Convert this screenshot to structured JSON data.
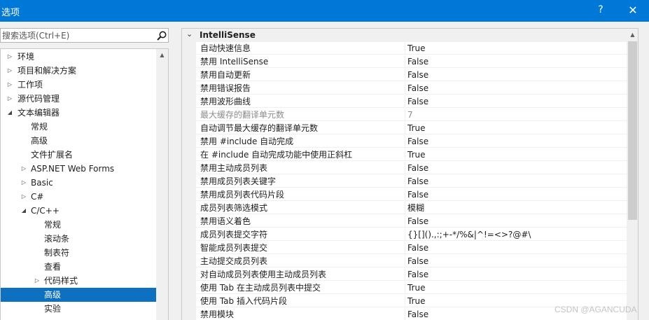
{
  "window": {
    "title": "选项",
    "help_label": "?",
    "close_label": "✕"
  },
  "search": {
    "placeholder": "搜索选项(Ctrl+E)",
    "icon": "search-icon"
  },
  "tree": {
    "items": [
      {
        "label": "环境",
        "indent": 0,
        "arrow": "collapsed"
      },
      {
        "label": "项目和解决方案",
        "indent": 0,
        "arrow": "collapsed"
      },
      {
        "label": "工作项",
        "indent": 0,
        "arrow": "collapsed"
      },
      {
        "label": "源代码管理",
        "indent": 0,
        "arrow": "collapsed"
      },
      {
        "label": "文本编辑器",
        "indent": 0,
        "arrow": "expanded"
      },
      {
        "label": "常规",
        "indent": 1,
        "arrow": "none"
      },
      {
        "label": "高级",
        "indent": 1,
        "arrow": "none"
      },
      {
        "label": "文件扩展名",
        "indent": 1,
        "arrow": "none"
      },
      {
        "label": "ASP.NET Web Forms",
        "indent": 1,
        "arrow": "collapsed"
      },
      {
        "label": "Basic",
        "indent": 1,
        "arrow": "collapsed"
      },
      {
        "label": "C#",
        "indent": 1,
        "arrow": "collapsed"
      },
      {
        "label": "C/C++",
        "indent": 1,
        "arrow": "expanded"
      },
      {
        "label": "常规",
        "indent": 2,
        "arrow": "none"
      },
      {
        "label": "滚动条",
        "indent": 2,
        "arrow": "none"
      },
      {
        "label": "制表符",
        "indent": 2,
        "arrow": "none"
      },
      {
        "label": "查看",
        "indent": 2,
        "arrow": "none"
      },
      {
        "label": "代码样式",
        "indent": 2,
        "arrow": "collapsed"
      },
      {
        "label": "高级",
        "indent": 2,
        "arrow": "none",
        "selected": true
      },
      {
        "label": "实验",
        "indent": 2,
        "arrow": "none"
      },
      {
        "label": "...",
        "indent": 2,
        "arrow": "none"
      }
    ]
  },
  "grid": {
    "category": "IntelliSense",
    "rows": [
      {
        "name": "自动快速信息",
        "value": "True"
      },
      {
        "name": "禁用 IntelliSense",
        "value": "False"
      },
      {
        "name": "禁用自动更新",
        "value": "False"
      },
      {
        "name": "禁用错误报告",
        "value": "False"
      },
      {
        "name": "禁用波形曲线",
        "value": "False"
      },
      {
        "name": "最大缓存的翻译单元数",
        "value": "7",
        "dim": true
      },
      {
        "name": "自动调节最大缓存的翻译单元数",
        "value": "True"
      },
      {
        "name": "禁用 #include 自动完成",
        "value": "False"
      },
      {
        "name": "在 #include 自动完成功能中使用正斜杠",
        "value": "True"
      },
      {
        "name": "禁用主动成员列表",
        "value": "False"
      },
      {
        "name": "禁用成员列表关键字",
        "value": "False"
      },
      {
        "name": "禁用成员列表代码片段",
        "value": "False"
      },
      {
        "name": "成员列表筛选模式",
        "value": "模糊"
      },
      {
        "name": "禁用语义着色",
        "value": "False"
      },
      {
        "name": "成员列表提交字符",
        "value": "{}[]().,:;+-*/%&|^!=<>?@#\\"
      },
      {
        "name": "智能成员列表提交",
        "value": "False"
      },
      {
        "name": "主动提交成员列表",
        "value": "False"
      },
      {
        "name": "对自动成员列表使用主动成员列表",
        "value": "False"
      },
      {
        "name": "使用 Tab 在主动成员列表中提交",
        "value": "True"
      },
      {
        "name": "使用 Tab 插入代码片段",
        "value": "True"
      },
      {
        "name": "禁用模块",
        "value": "False"
      }
    ]
  },
  "watermark": "CSDN @AGANCUDA"
}
